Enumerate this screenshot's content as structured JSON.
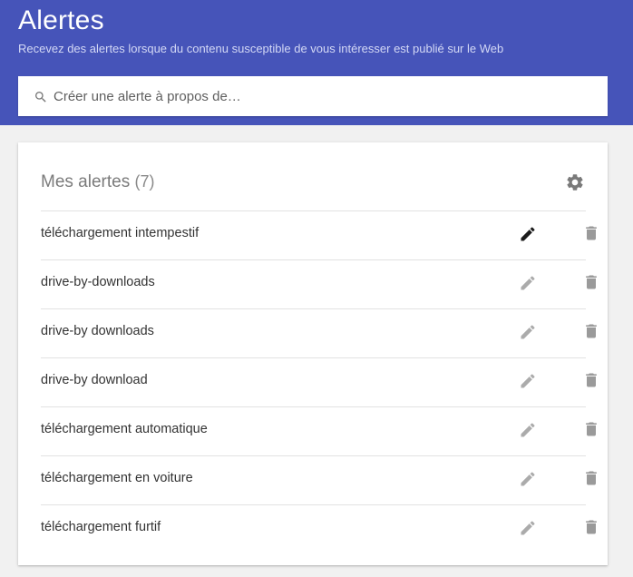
{
  "header": {
    "title": "Alertes",
    "subtitle": "Recevez des alertes lorsque du contenu susceptible de vous intéresser est publié sur le Web",
    "background_color": "#4654b9"
  },
  "search": {
    "icon": "search-icon",
    "placeholder": "Créer une alerte à propos de…",
    "value": ""
  },
  "alerts_panel": {
    "title": "Mes alertes",
    "count": "(7)",
    "settings_icon": "gear-icon",
    "items": [
      {
        "label": "téléchargement intempestif",
        "edit_icon": "pencil-icon",
        "delete_icon": "trash-icon",
        "edit_active": true
      },
      {
        "label": "drive-by-downloads",
        "edit_icon": "pencil-icon",
        "delete_icon": "trash-icon",
        "edit_active": false
      },
      {
        "label": "drive-by downloads",
        "edit_icon": "pencil-icon",
        "delete_icon": "trash-icon",
        "edit_active": false
      },
      {
        "label": "drive-by download",
        "edit_icon": "pencil-icon",
        "delete_icon": "trash-icon",
        "edit_active": false
      },
      {
        "label": "téléchargement automatique",
        "edit_icon": "pencil-icon",
        "delete_icon": "trash-icon",
        "edit_active": false
      },
      {
        "label": "téléchargement en voiture",
        "edit_icon": "pencil-icon",
        "delete_icon": "trash-icon",
        "edit_active": false
      },
      {
        "label": "téléchargement furtif",
        "edit_icon": "pencil-icon",
        "delete_icon": "trash-icon",
        "edit_active": false
      }
    ]
  },
  "colors": {
    "icon_active": "#1b1b1b",
    "icon_inactive": "#ababab",
    "trash": "#9a9a9a"
  }
}
